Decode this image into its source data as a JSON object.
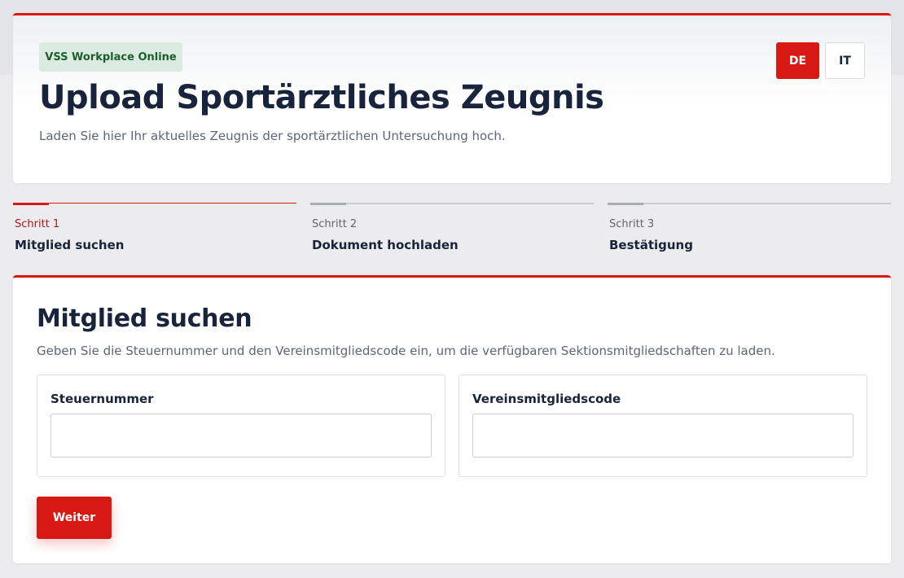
{
  "header": {
    "badge": "VSS Workplace Online",
    "title": "Upload Sportärztliches Zeugnis",
    "subtitle": "Laden Sie hier Ihr aktuelles Zeugnis der sportärztlichen Untersuchung hoch.",
    "languages": [
      {
        "code": "DE",
        "active": true
      },
      {
        "code": "IT",
        "active": false
      }
    ]
  },
  "steps": [
    {
      "label": "Schritt 1",
      "name": "Mitglied suchen",
      "active": true
    },
    {
      "label": "Schritt 2",
      "name": "Dokument hochladen",
      "active": false
    },
    {
      "label": "Schritt 3",
      "name": "Bestätigung",
      "active": false
    }
  ],
  "form": {
    "title": "Mitglied suchen",
    "description": "Geben Sie die Steuernummer und den Vereinsmitgliedscode ein, um die verfügbaren Sektionsmitgliedschaften zu laden.",
    "fields": [
      {
        "label": "Steuernummer",
        "value": ""
      },
      {
        "label": "Vereinsmitgliedscode",
        "value": ""
      }
    ],
    "submit_label": "Weiter"
  },
  "colors": {
    "accent": "#d81812",
    "badge_bg": "#dcebdf",
    "badge_text": "#1d5e2c",
    "heading": "#17243b"
  }
}
